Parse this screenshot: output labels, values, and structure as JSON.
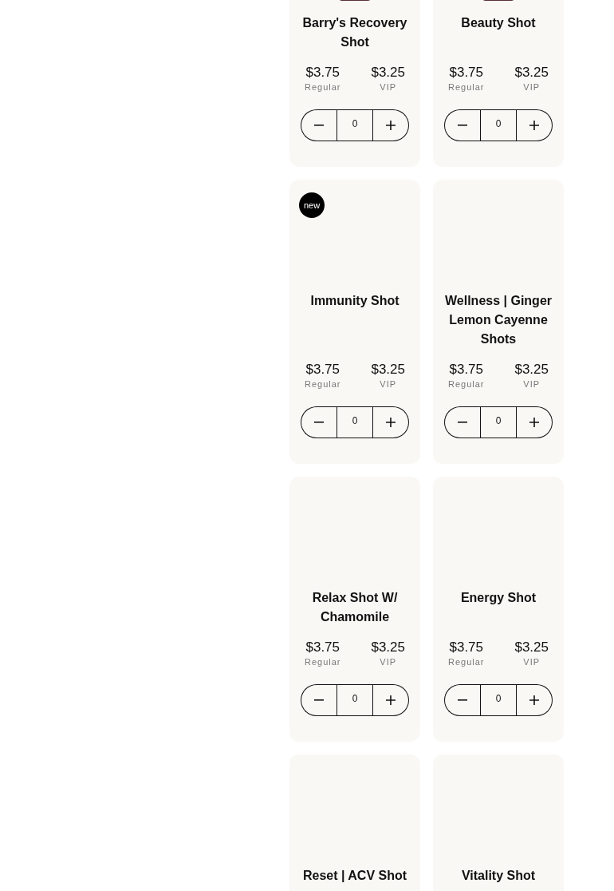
{
  "products": [
    {
      "name": "Barry's Recovery Shot",
      "photo": true,
      "prices": [
        {
          "amount": "$3.75",
          "label": "Regular"
        },
        {
          "amount": "$3.25",
          "label": "VIP"
        }
      ],
      "quantity": "0"
    },
    {
      "name": "Beauty Shot",
      "photo": true,
      "prices": [
        {
          "amount": "$3.75",
          "label": "Regular"
        },
        {
          "amount": "$3.25",
          "label": "VIP"
        }
      ],
      "quantity": "0"
    },
    {
      "name": "Immunity Shot",
      "photo": false,
      "badge": "new",
      "prices": [
        {
          "amount": "$3.75",
          "label": "Regular"
        },
        {
          "amount": "$3.25",
          "label": "VIP"
        }
      ],
      "quantity": "0"
    },
    {
      "name": "Wellness | Ginger Lemon Cayenne Shots",
      "photo": false,
      "prices": [
        {
          "amount": "$3.75",
          "label": "Regular"
        },
        {
          "amount": "$3.25",
          "label": "VIP"
        }
      ],
      "quantity": "0"
    },
    {
      "name": "Relax Shot W/ Chamomile",
      "photo": false,
      "prices": [
        {
          "amount": "$3.75",
          "label": "Regular"
        },
        {
          "amount": "$3.25",
          "label": "VIP"
        }
      ],
      "quantity": "0"
    },
    {
      "name": "Energy Shot",
      "photo": false,
      "prices": [
        {
          "amount": "$3.75",
          "label": "Regular"
        },
        {
          "amount": "$3.25",
          "label": "VIP"
        }
      ],
      "quantity": "0"
    },
    {
      "name": "Reset | ACV Shot",
      "photo": false
    },
    {
      "name": "Vitality Shot",
      "photo": false
    }
  ]
}
